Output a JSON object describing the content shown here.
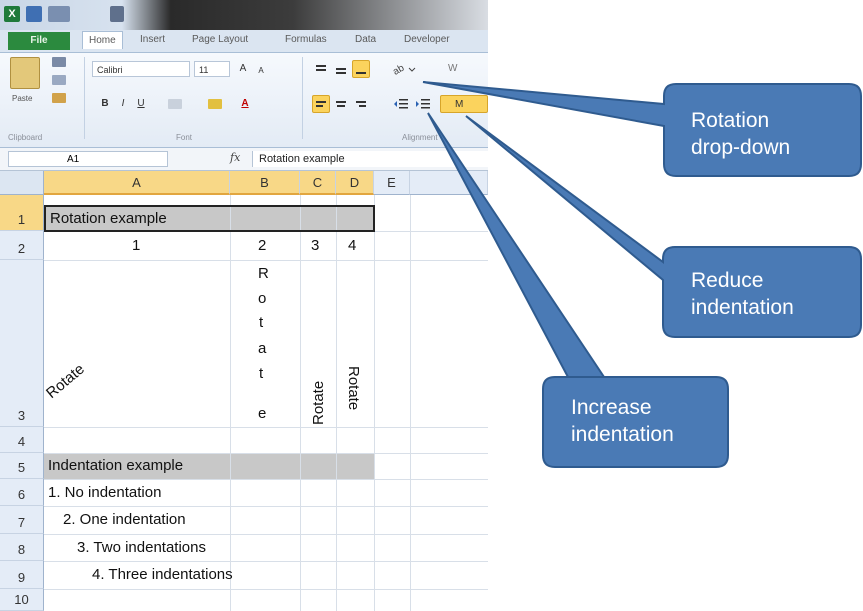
{
  "quick_access": {
    "app_icon": "X"
  },
  "tabs": [
    "File",
    "Home",
    "Insert",
    "Page Layout",
    "Formulas",
    "Data",
    "Developer"
  ],
  "ribbon": {
    "paste_label": "Paste",
    "font_name": "Calibri",
    "font_size": "11",
    "grow_font": "A",
    "shrink_font": "A",
    "bold": "B",
    "italic": "I",
    "underline": "U",
    "font_color": "A",
    "wrap_text": "W",
    "merge": "M",
    "group_clipboard": "Clipboard",
    "group_font": "Font",
    "group_alignment": "Alignment"
  },
  "formula_bar": {
    "cell_ref": "A1",
    "fx": "fx",
    "content": "Rotation example"
  },
  "columns": [
    "A",
    "B",
    "C",
    "D",
    "E"
  ],
  "rows": [
    "1",
    "2",
    "3",
    "4",
    "5",
    "6",
    "7",
    "8",
    "9",
    "10"
  ],
  "cells": {
    "a1": "Rotation example",
    "a2": "1",
    "b2": "2",
    "c2": "3",
    "d2": "4",
    "a3": "Rotate",
    "b3_letters": [
      "R",
      "o",
      "t",
      "a",
      "t",
      "e"
    ],
    "c3": "Rotate",
    "d3": "Rotate",
    "a5": "Indentation example",
    "a6": "1. No indentation",
    "a7": "2. One indentation",
    "a8": "3. Two indentations",
    "a9": "4. Three indentations"
  },
  "callouts": {
    "rotation": [
      "Rotation",
      "drop-down"
    ],
    "reduce": [
      "Reduce",
      "indentation"
    ],
    "increase": [
      "Increase",
      "indentation"
    ]
  },
  "colors": {
    "callout_fill": "#4a7ab5",
    "callout_stroke": "#2f5b8f",
    "header_selected": "#f8d887",
    "band_gray": "#c8c8c8"
  }
}
